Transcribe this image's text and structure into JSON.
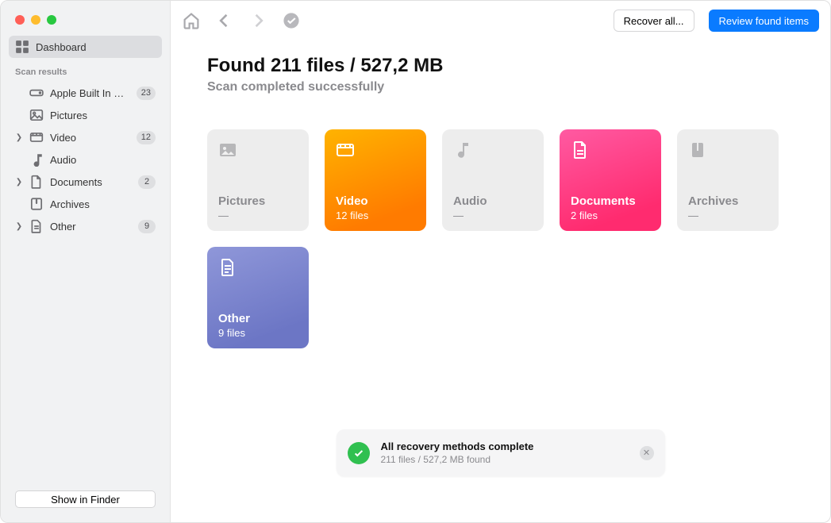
{
  "sidebar": {
    "dashboard": "Dashboard",
    "section": "Scan results",
    "items": [
      {
        "label": "Apple Built In SDX...",
        "badge": "23",
        "chev": false
      },
      {
        "label": "Pictures",
        "badge": null,
        "chev": false
      },
      {
        "label": "Video",
        "badge": "12",
        "chev": true
      },
      {
        "label": "Audio",
        "badge": null,
        "chev": false
      },
      {
        "label": "Documents",
        "badge": "2",
        "chev": true
      },
      {
        "label": "Archives",
        "badge": null,
        "chev": false
      },
      {
        "label": "Other",
        "badge": "9",
        "chev": true
      }
    ],
    "show_in_finder": "Show in Finder"
  },
  "toolbar": {
    "recover_all": "Recover all...",
    "review": "Review found items"
  },
  "main": {
    "headline": "Found 211 files / 527,2 MB",
    "subhead": "Scan completed successfully"
  },
  "cards": [
    {
      "title": "Pictures",
      "sub": "—",
      "variant": "muted"
    },
    {
      "title": "Video",
      "sub": "12 files",
      "variant": "video"
    },
    {
      "title": "Audio",
      "sub": "—",
      "variant": "muted"
    },
    {
      "title": "Documents",
      "sub": "2 files",
      "variant": "documents"
    },
    {
      "title": "Archives",
      "sub": "—",
      "variant": "muted"
    },
    {
      "title": "Other",
      "sub": "9 files",
      "variant": "other"
    }
  ],
  "toast": {
    "title": "All recovery methods complete",
    "sub": "211 files / 527,2 MB found"
  }
}
